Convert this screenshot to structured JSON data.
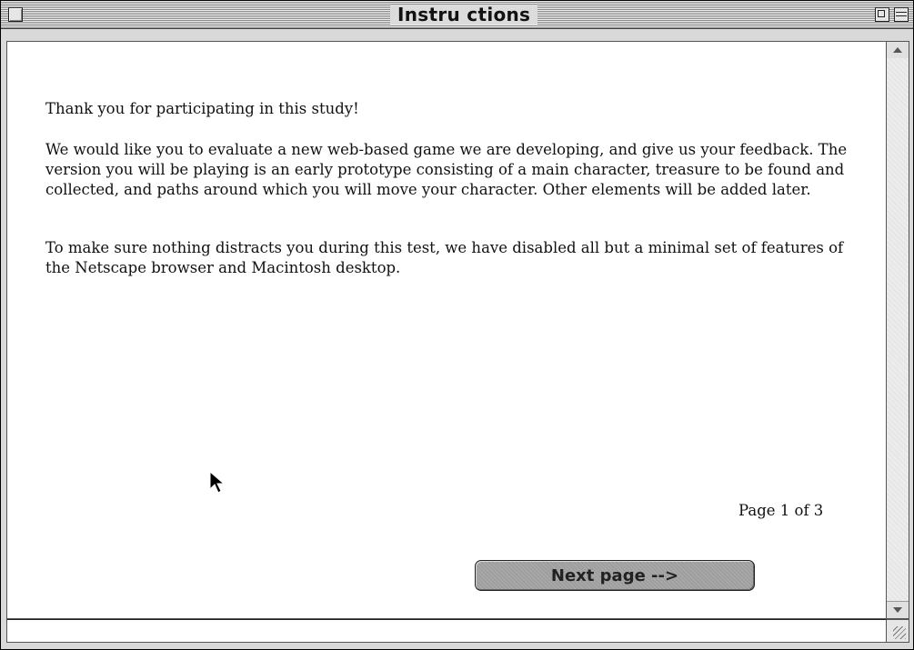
{
  "window": {
    "title": "Instru ctions"
  },
  "content": {
    "paragraphs": [
      "Thank you for participating in this study!",
      "We would like you to evaluate a new web-based game we are developing, and give us your feedback.  The version you will be playing is an early prototype consisting of a main character, treasure to be found and collected, and paths around which you will move your character.  Other elements will be added later.",
      "To make sure nothing distracts you during this test, we have disabled all but a minimal set of features of the Netscape browser and Macintosh desktop."
    ],
    "page_indicator": "Page 1 of 3",
    "next_button_label": "Next page -->"
  },
  "icons": {
    "close": "close-box-icon",
    "zoom": "zoom-box-icon",
    "collapse": "collapse-box-icon",
    "cursor": "arrow-cursor-icon",
    "scroll_up": "scroll-up-arrow-icon",
    "scroll_down": "scroll-down-arrow-icon",
    "grow": "grow-box-icon"
  },
  "colors": {
    "button_fill": "#9e9e9e",
    "content_bg": "#ffffff",
    "chrome": "#d9d9d9"
  }
}
